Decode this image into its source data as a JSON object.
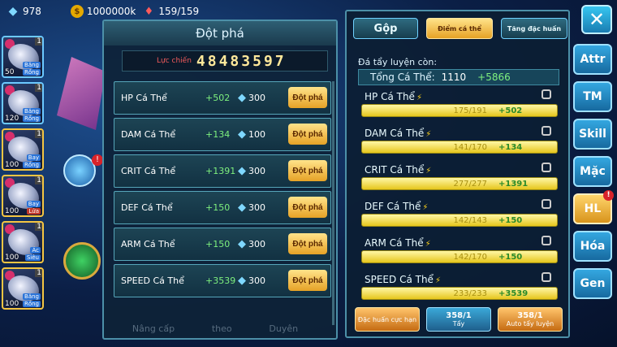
{
  "topbar": {
    "diamonds": "978",
    "gold": "1000000k",
    "energy": "159/159"
  },
  "roster": [
    {
      "level": "50",
      "tag1": "Băng",
      "tag2": "Rồng",
      "num": "1"
    },
    {
      "level": "120",
      "tag1": "Băng",
      "tag2": "Rồng",
      "num": "1"
    },
    {
      "level": "100",
      "tag1": "Bay",
      "tag2": "Rồng",
      "num": "1"
    },
    {
      "level": "100",
      "tag1": "Bay",
      "tag2": "Lửa",
      "num": "1"
    },
    {
      "level": "100",
      "tag1": "Ác",
      "tag2": "Siêu",
      "num": "1"
    },
    {
      "level": "100",
      "tag1": "Băng",
      "tag2": "Rồng",
      "num": "1"
    }
  ],
  "breakthrough": {
    "title": "Đột phá",
    "power_label": "Lực chiến",
    "power_value": "48483597",
    "rows": [
      {
        "name": "HP Cá Thể",
        "bonus": "+502",
        "cost": "300",
        "button": "Đột phá"
      },
      {
        "name": "DAM Cá Thể",
        "bonus": "+134",
        "cost": "100",
        "button": "Đột phá"
      },
      {
        "name": "CRIT Cá Thể",
        "bonus": "+1391",
        "cost": "300",
        "button": "Đột phá"
      },
      {
        "name": "DEF Cá Thể",
        "bonus": "+150",
        "cost": "300",
        "button": "Đột phá"
      },
      {
        "name": "ARM Cá Thể",
        "bonus": "+150",
        "cost": "300",
        "button": "Đột phá"
      },
      {
        "name": "SPEED Cá Thể",
        "bonus": "+3539",
        "cost": "300",
        "button": "Đột phá"
      }
    ]
  },
  "detail": {
    "tab_merge": "Gộp",
    "tab_iv": "Điểm cá thể",
    "tab_special": "Tăng đặc huấn",
    "train_label": "Đá tẩy luyện còn:",
    "total_label": "Tổng Cá Thể:",
    "total_value": "1110",
    "total_bonus": "+5866",
    "stats": [
      {
        "name": "HP Cá Thể",
        "value": "175/191",
        "bonus": "+502"
      },
      {
        "name": "DAM Cá Thể",
        "value": "141/170",
        "bonus": "+134"
      },
      {
        "name": "CRIT Cá Thể",
        "value": "277/277",
        "bonus": "+1391"
      },
      {
        "name": "DEF Cá Thể",
        "value": "142/143",
        "bonus": "+150"
      },
      {
        "name": "ARM Cá Thể",
        "value": "142/170",
        "bonus": "+150"
      },
      {
        "name": "SPEED Cá Thể",
        "value": "233/233",
        "bonus": "+3539"
      }
    ],
    "btn_special": "Đặc huấn cực hạn",
    "btn_wash_count": "358/1",
    "btn_wash": "Tẩy",
    "btn_auto_count": "358/1",
    "btn_auto": "Auto tẩy luyện"
  },
  "side": [
    "Attr",
    "TM",
    "Skill",
    "Mặc",
    "HL",
    "Hóa",
    "Gen"
  ],
  "ghost_tabs": [
    "Nâng cấp",
    "theo",
    "Duyên"
  ]
}
